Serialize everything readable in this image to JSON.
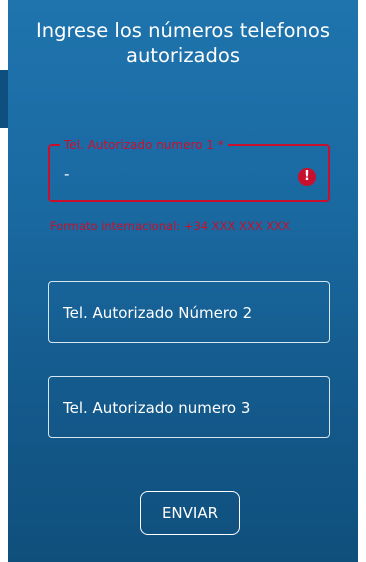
{
  "header": {
    "title_line1": "Ingrese los números telefonos",
    "title_line2": "autorizados"
  },
  "form": {
    "phone1": {
      "label": "Tel. Autorizado numero 1 *",
      "value": "-",
      "error_icon": "error-icon",
      "error_glyph": "!",
      "helper_text": "Formato internacional: +34 XXX XXX XXX"
    },
    "phone2": {
      "placeholder": "Tel. Autorizado Número 2"
    },
    "phone3": {
      "placeholder": "Tel. Autorizado numero 3"
    },
    "submit_label": "ENVIAR"
  },
  "colors": {
    "background_top": "#1f74ad",
    "background_bottom": "#0f4f7c",
    "error": "#c8102e",
    "text": "#ffffff"
  }
}
